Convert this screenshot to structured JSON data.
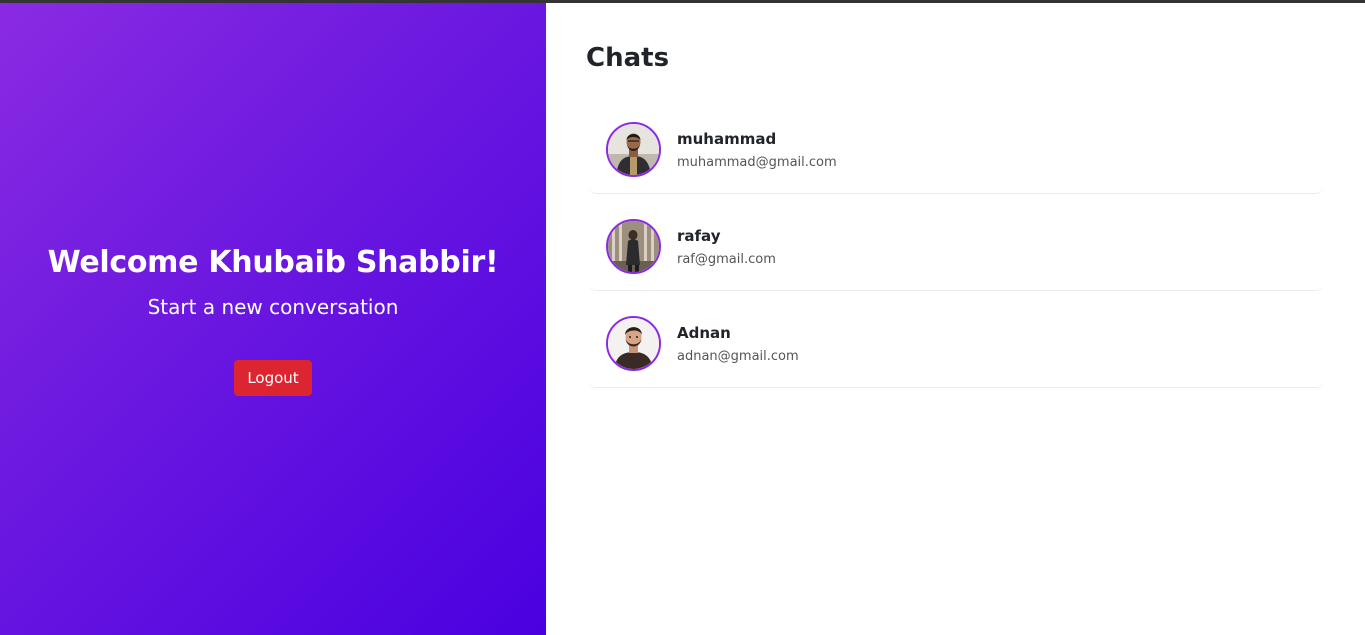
{
  "left": {
    "welcome": "Welcome Khubaib Shabbir!",
    "subtitle": "Start a new conversation",
    "logout_label": "Logout"
  },
  "right": {
    "title": "Chats",
    "chats": [
      {
        "name": "muhammad",
        "email": "muhammad@gmail.com",
        "avatar": "user-photo-icon"
      },
      {
        "name": "rafay",
        "email": "raf@gmail.com",
        "avatar": "user-photo-icon"
      },
      {
        "name": "Adnan",
        "email": "adnan@gmail.com",
        "avatar": "user-photo-icon"
      }
    ]
  },
  "colors": {
    "gradient_start": "#8a2be2",
    "gradient_end": "#4a00e0",
    "logout_button": "#dc2530",
    "avatar_border": "#8a2be2"
  }
}
